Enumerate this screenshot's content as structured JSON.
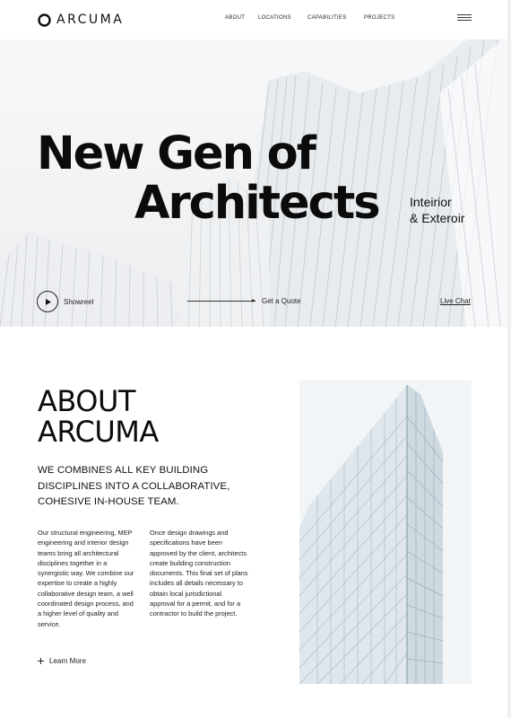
{
  "brand": {
    "name": "ARCUMA"
  },
  "nav": {
    "items": [
      "ABOUT",
      "LOCATIONS",
      "CAPABILITIES",
      "PROJECTS"
    ]
  },
  "hero": {
    "title_line1": "New Gen of",
    "title_line2": "Architects",
    "subtitle_line1": "Inteirior",
    "subtitle_line2": "& Exteroir",
    "showreel_label": "Showreel",
    "quote_label": "Get a Quote",
    "livechat_label": "Live Chat"
  },
  "about": {
    "title_line1": "ABOUT",
    "title_line2": "ARCUMA",
    "lead": "WE COMBINES ALL KEY BUILDING DISCIPLINES INTO A COLLABORATIVE, COHESIVE IN-HOUSE TEAM.",
    "col1": "Our structural engineering, MEP engineering and interior design teams bring all architectural disciplines together in a synergistic way. We combine our expertise to create a highly collaborative design team, a well coordinated design process, and a higher level of quality and service.",
    "col2": "Once design drawings and specifications have been approved by the client, architects create building construction documents. This final set of plans includes all details necessary to obtain local jurisdictional approval for a permit, and for a contractor to build the project.",
    "learn_more": "Learn More"
  },
  "icons": {
    "logo": "arc-logo-icon",
    "menu": "hamburger-menu-icon",
    "play": "play-icon",
    "arrow": "arrow-right-icon",
    "plus": "plus-icon"
  },
  "colors": {
    "text": "#111111",
    "hero_bg": "#f4f5f6"
  }
}
